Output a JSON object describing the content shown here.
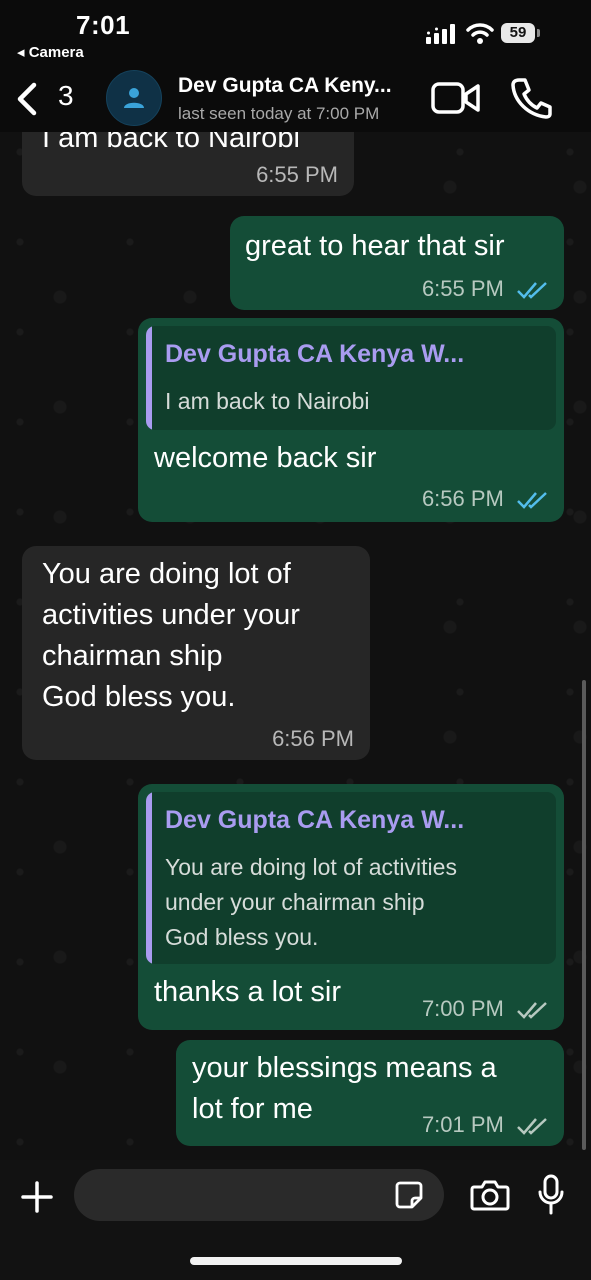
{
  "status_bar": {
    "time": "7:01",
    "back_app": "◂ Camera",
    "battery": "59",
    "icons": [
      "signal-icon",
      "wifi-icon",
      "battery-icon"
    ]
  },
  "header": {
    "unread_count": "3",
    "contact_name": "Dev Gupta  CA Keny...",
    "last_seen": "last seen today at 7:00 PM",
    "icons": [
      "back-chevron-icon",
      "avatar-person-icon",
      "video-call-icon",
      "phone-call-icon"
    ]
  },
  "messages": [
    {
      "dir": "in",
      "text": "I am back to Nairobi",
      "time": "6:55 PM"
    },
    {
      "dir": "out",
      "text": "great to hear that sir",
      "time": "6:55 PM",
      "status": "read"
    },
    {
      "dir": "out",
      "quote_author": "Dev Gupta  CA Kenya W...",
      "quote_text": "I am back to Nairobi",
      "text": "welcome back sir",
      "time": "6:56 PM",
      "status": "read"
    },
    {
      "dir": "in",
      "text": "You are doing lot of activities under your chairman ship God bless you.",
      "lines": [
        "You are doing lot of",
        "activities under your",
        "chairman ship",
        "God bless you."
      ],
      "time": "6:56 PM"
    },
    {
      "dir": "out",
      "quote_author": "Dev Gupta  CA Kenya W...",
      "quote_lines": [
        "You are doing lot of activities",
        "under your chairman ship",
        "God bless you."
      ],
      "text": "thanks a lot sir",
      "time": "7:00 PM",
      "status": "delivered"
    },
    {
      "dir": "out",
      "lines": [
        "your blessings means a",
        "lot for me"
      ],
      "time": "7:01 PM",
      "status": "delivered"
    }
  ],
  "composer": {
    "placeholder": "",
    "icons": [
      "plus-icon",
      "sticker-icon",
      "camera-icon",
      "microphone-icon"
    ]
  },
  "colors": {
    "incoming_bubble": "#262626",
    "outgoing_bubble": "#144d37",
    "quote_accent": "#a99cf0",
    "read_ticks": "#53bdeb",
    "delivered_ticks": "#b7c9c0"
  }
}
